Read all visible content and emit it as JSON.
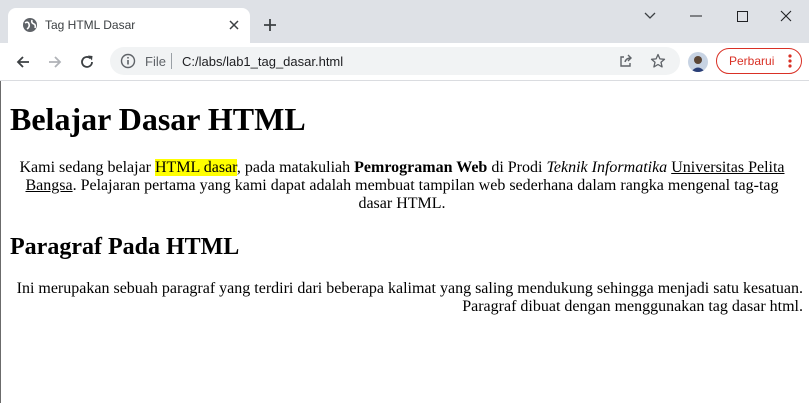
{
  "browser": {
    "tab": {
      "title": "Tag HTML Dasar"
    },
    "address_bar": {
      "scheme_label": "File",
      "url": "C:/labs/lab1_tag_dasar.html"
    },
    "update_button": {
      "label": "Perbarui"
    },
    "colors": {
      "tabstrip": "#dee1e6",
      "omnibox": "#f1f3f4",
      "update_accent": "#d93025"
    }
  },
  "page": {
    "heading1": "Belajar Dasar HTML",
    "paragraph1": {
      "t1": "Kami sedang belajar ",
      "highlight": "HTML dasar",
      "t2": ", pada matakuliah ",
      "bold": "Pemrograman Web",
      "t3": " di Prodi ",
      "italic": "Teknik Informatika",
      "t4": " ",
      "link": "Universitas Pelita Bangsa",
      "t5": ". Pelajaran pertama yang kami dapat adalah membuat tampilan web sederhana dalam rangka mengenal tag-tag dasar HTML."
    },
    "heading2": "Paragraf Pada HTML",
    "paragraph2": "Ini merupakan sebuah paragraf yang terdiri dari beberapa kalimat yang saling mendukung sehingga menjadi satu kesatuan. Paragraf dibuat dengan menggunakan tag dasar html.",
    "colors": {
      "highlight": "#ffff00"
    }
  }
}
